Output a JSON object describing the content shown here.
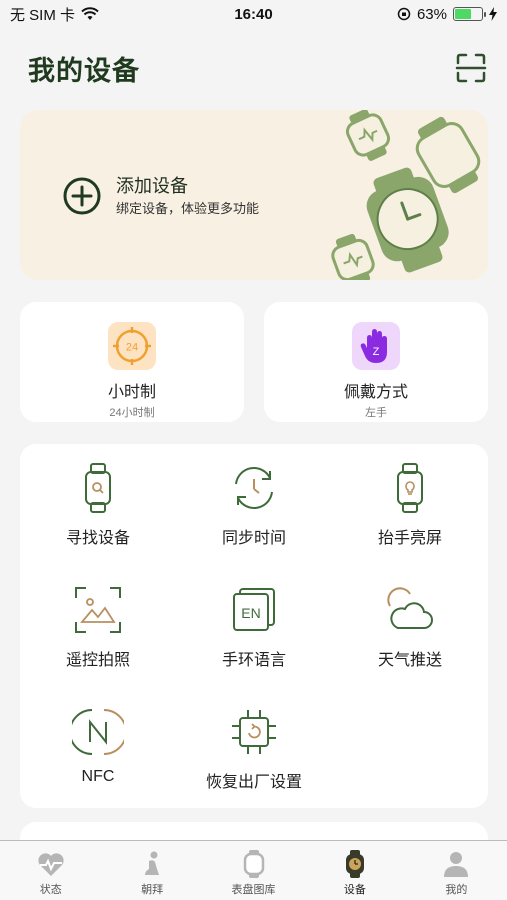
{
  "status_bar": {
    "carrier": "无 SIM 卡",
    "time": "16:40",
    "battery_percent": "63%",
    "battery_level": 0.63
  },
  "header": {
    "title": "我的设备"
  },
  "add_device": {
    "title": "添加设备",
    "subtitle": "绑定设备，体验更多功能"
  },
  "quick_cards": {
    "hour_format": {
      "label": "小时制",
      "value": "24小时制",
      "icon_text": "24"
    },
    "wear_mode": {
      "label": "佩戴方式",
      "value": "左手",
      "icon_text": "Z"
    }
  },
  "features": [
    {
      "label": "寻找设备",
      "icon": "find-watch-icon"
    },
    {
      "label": "同步时间",
      "icon": "sync-time-icon"
    },
    {
      "label": "抬手亮屏",
      "icon": "raise-wake-icon"
    },
    {
      "label": "遥控拍照",
      "icon": "remote-camera-icon"
    },
    {
      "label": "手环语言",
      "icon": "language-icon"
    },
    {
      "label": "天气推送",
      "icon": "weather-icon"
    },
    {
      "label": "NFC",
      "icon": "nfc-icon"
    },
    {
      "label": "恢复出厂设置",
      "icon": "factory-reset-icon"
    }
  ],
  "language_icon_text": "EN",
  "tabs": [
    {
      "label": "状态",
      "icon": "heart-rate-icon"
    },
    {
      "label": "朝拜",
      "icon": "prayer-icon"
    },
    {
      "label": "表盘图库",
      "icon": "watch-face-icon"
    },
    {
      "label": "设备",
      "icon": "device-icon",
      "active": true
    },
    {
      "label": "我的",
      "icon": "profile-icon"
    }
  ],
  "colors": {
    "accent_green": "#3f6b3a",
    "card_beige": "#f7f0e3",
    "orange": "#f0a030",
    "purple": "#8a2be2"
  }
}
